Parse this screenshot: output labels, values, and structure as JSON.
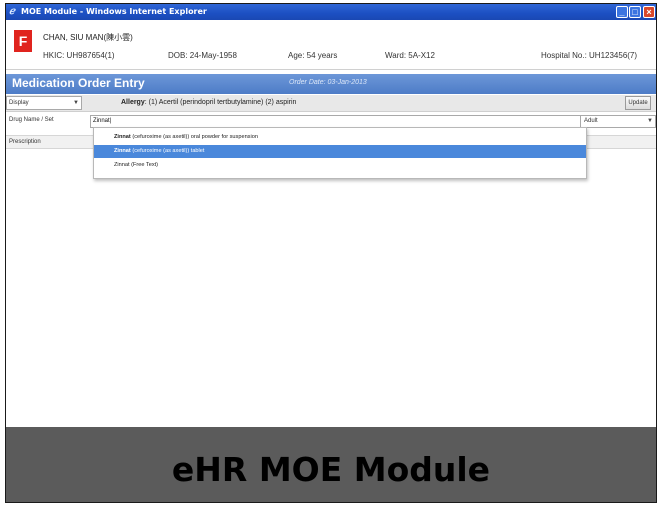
{
  "window": {
    "title": "MOE Module - Windows Internet Explorer"
  },
  "patient": {
    "flag": "F",
    "name": "CHAN, SIU MAN(陳小雲)",
    "hkic": "HKIC: UH987654(1)",
    "dob": "DOB: 24-May-1958",
    "age": "Age: 54 years",
    "ward": "Ward: 5A-X12",
    "hospital_no": "Hospital No.: UH123456(7)"
  },
  "moe": {
    "title": "Medication Order Entry",
    "order_date": "Order Date: 03-Jan-2013"
  },
  "allergy_row": {
    "display_select": "Display",
    "allergy_label": "Allergy",
    "allergy_text": ": (1) Acertil (perindopril tertbutylamine) (2) aspirin",
    "update_label": "Update"
  },
  "drug_row": {
    "label": "Drug Name / Set",
    "input_value": "Zinnat|",
    "age_group": "Adult"
  },
  "prescription": {
    "label": "Prescription"
  },
  "dropdown": {
    "items": [
      {
        "bold": "Zinnat",
        "rest": " (cefuroxime (as axetil)) oral powder for suspension"
      },
      {
        "bold": "Zinnat",
        "rest": " (cefuroxime (as axetil)) tablet"
      },
      {
        "bold": "",
        "rest": "Zinnat (Free Text)"
      }
    ],
    "selected_index": 1
  },
  "caption": {
    "text": "eHR MOE Module"
  },
  "icons": {
    "flag": "warning-flag-icon",
    "arrow": "chevron-down-icon"
  },
  "colors": {
    "titlebar": "#1c4fc2",
    "moebar": "#4d7cc7",
    "selected": "#4a88db",
    "flag": "#e0241e",
    "caption_bg": "#5b5b5b"
  }
}
